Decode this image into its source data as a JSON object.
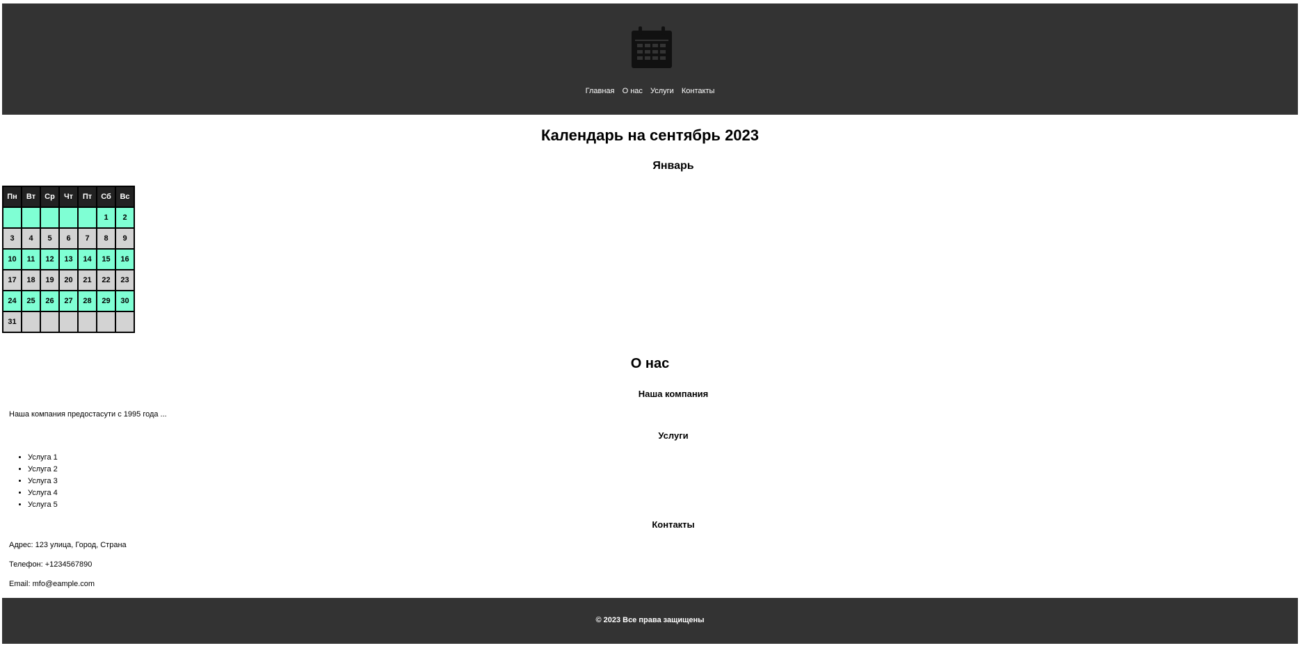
{
  "header": {
    "logo_icon": "calendar-icon",
    "nav": [
      "Главная",
      "О нас",
      "Услуги",
      "Контакты"
    ]
  },
  "main": {
    "title": "Календарь на сентябрь 2023",
    "month": "Январь",
    "calendar": {
      "weekdays": [
        "Пн",
        "Вт",
        "Ср",
        "Чт",
        "Пт",
        "Сб",
        "Вс"
      ],
      "weeks": [
        [
          "",
          "",
          "",
          "",
          "",
          "1",
          "2"
        ],
        [
          "3",
          "4",
          "5",
          "6",
          "7",
          "8",
          "9"
        ],
        [
          "10",
          "11",
          "12",
          "13",
          "14",
          "15",
          "16"
        ],
        [
          "17",
          "18",
          "19",
          "20",
          "21",
          "22",
          "23"
        ],
        [
          "24",
          "25",
          "26",
          "27",
          "28",
          "29",
          "30"
        ],
        [
          "31",
          "",
          "",
          "",
          "",
          "",
          ""
        ]
      ],
      "row_colors": [
        "#7fffd4",
        "#d3d3d3"
      ]
    }
  },
  "about": {
    "title": "О нас",
    "company_title": "Наша компания",
    "company_text": "Наша компания предостасути с 1995 года ...",
    "services_title": "Услуги",
    "services": [
      "Услуга 1",
      "Услуга 2",
      "Услуга 3",
      "Услуга 4",
      "Услуга 5"
    ],
    "contacts_title": "Контакты",
    "address": "Адрес: 123 улица, Город, Страна",
    "phone": "Телефон: +1234567890",
    "email": "Email: mfo@eample.com"
  },
  "footer": {
    "text": "© 2023 Все права защищены"
  },
  "colors": {
    "header_bg": "#333333",
    "calendar_header_bg": "#222222",
    "highlight_row": "#7fffd4",
    "alt_row": "#d3d3d3"
  }
}
